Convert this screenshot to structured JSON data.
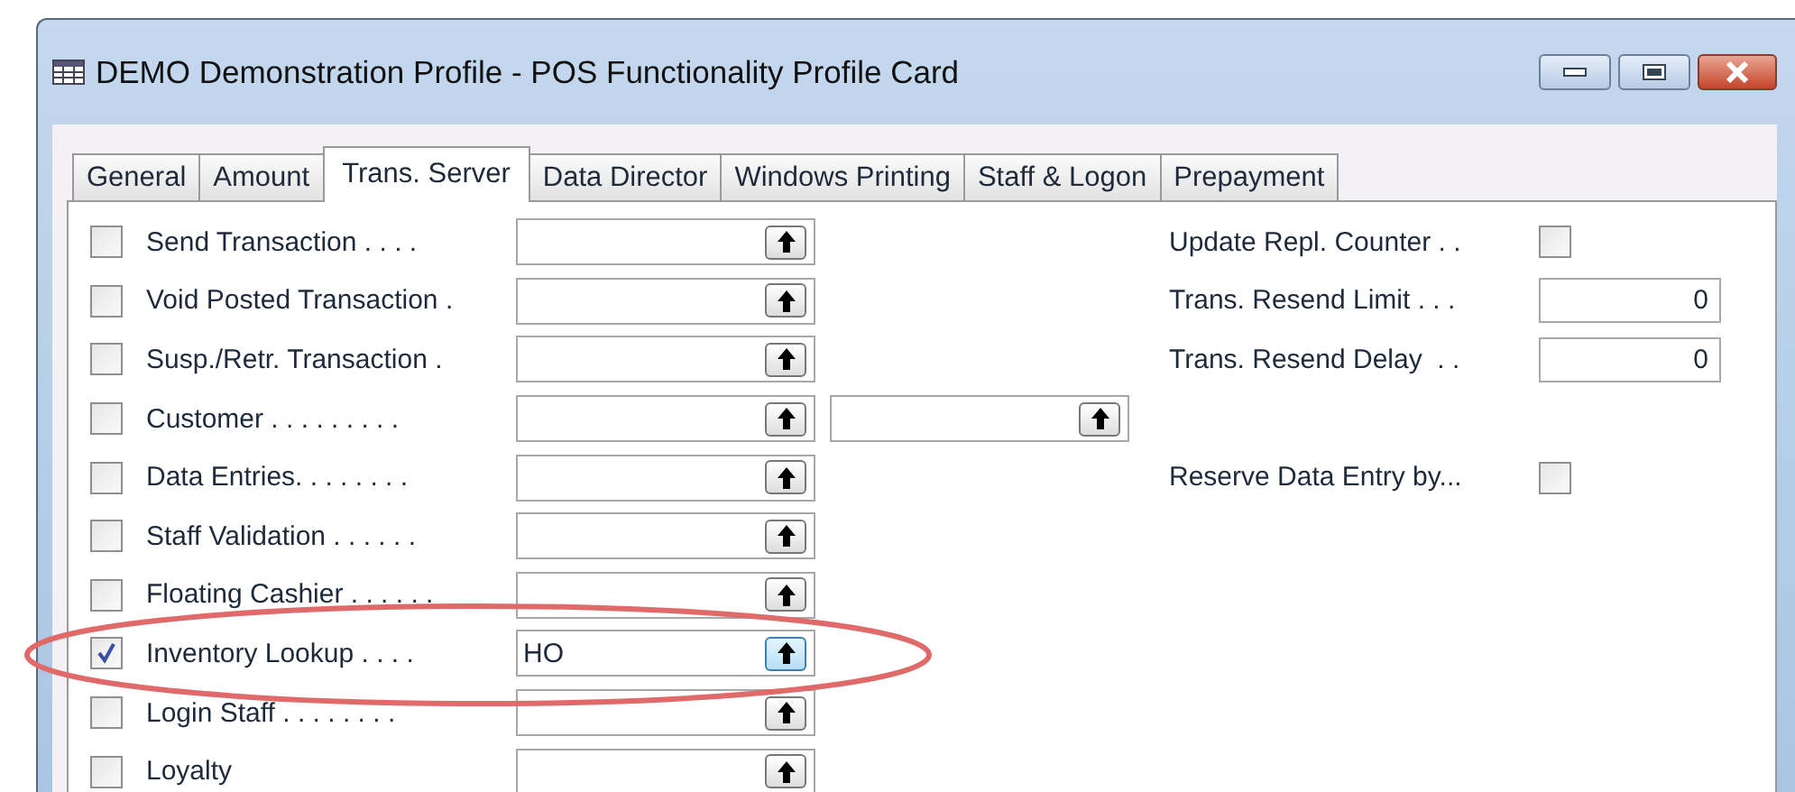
{
  "window": {
    "title": "DEMO Demonstration Profile - POS Functionality Profile Card"
  },
  "tabs": [
    {
      "label": "General",
      "selected": false
    },
    {
      "label": "Amount",
      "selected": false
    },
    {
      "label": "Trans. Server",
      "selected": true
    },
    {
      "label": "Data Director",
      "selected": false
    },
    {
      "label": "Windows Printing",
      "selected": false
    },
    {
      "label": "Staff & Logon",
      "selected": false
    },
    {
      "label": "Prepayment",
      "selected": false
    }
  ],
  "rows": [
    {
      "label": "Send Transaction . . . .",
      "checked": false,
      "value": "",
      "side": {
        "kind": "checkbox",
        "label": "Update Repl. Counter . .",
        "checked": false
      }
    },
    {
      "label": "Void Posted Transaction .",
      "checked": false,
      "value": "",
      "side": {
        "kind": "number",
        "label": "Trans. Resend Limit . . .",
        "value": "0"
      }
    },
    {
      "label": "Susp./Retr. Transaction .",
      "checked": false,
      "value": "",
      "side": {
        "kind": "number",
        "label": "Trans. Resend Delay  . .",
        "value": "0"
      }
    },
    {
      "label": "Customer . . . . . . . . .",
      "checked": false,
      "value": "",
      "extra_field": true
    },
    {
      "label": "Data Entries. . . . . . . .",
      "checked": false,
      "value": "",
      "side": {
        "kind": "checkbox",
        "label": "Reserve Data Entry by...",
        "checked": false
      }
    },
    {
      "label": "Staff Validation . . . . . .",
      "checked": false,
      "value": ""
    },
    {
      "label": "Floating Cashier . . . . . .",
      "checked": false,
      "value": ""
    },
    {
      "label": "Inventory Lookup . . . .",
      "checked": true,
      "value": "HO",
      "lookup_focused": true,
      "highlighted": true
    },
    {
      "label": "Login Staff . . . . . . . .",
      "checked": false,
      "value": ""
    },
    {
      "label": "Loyalty",
      "checked": false,
      "value": ""
    }
  ]
}
